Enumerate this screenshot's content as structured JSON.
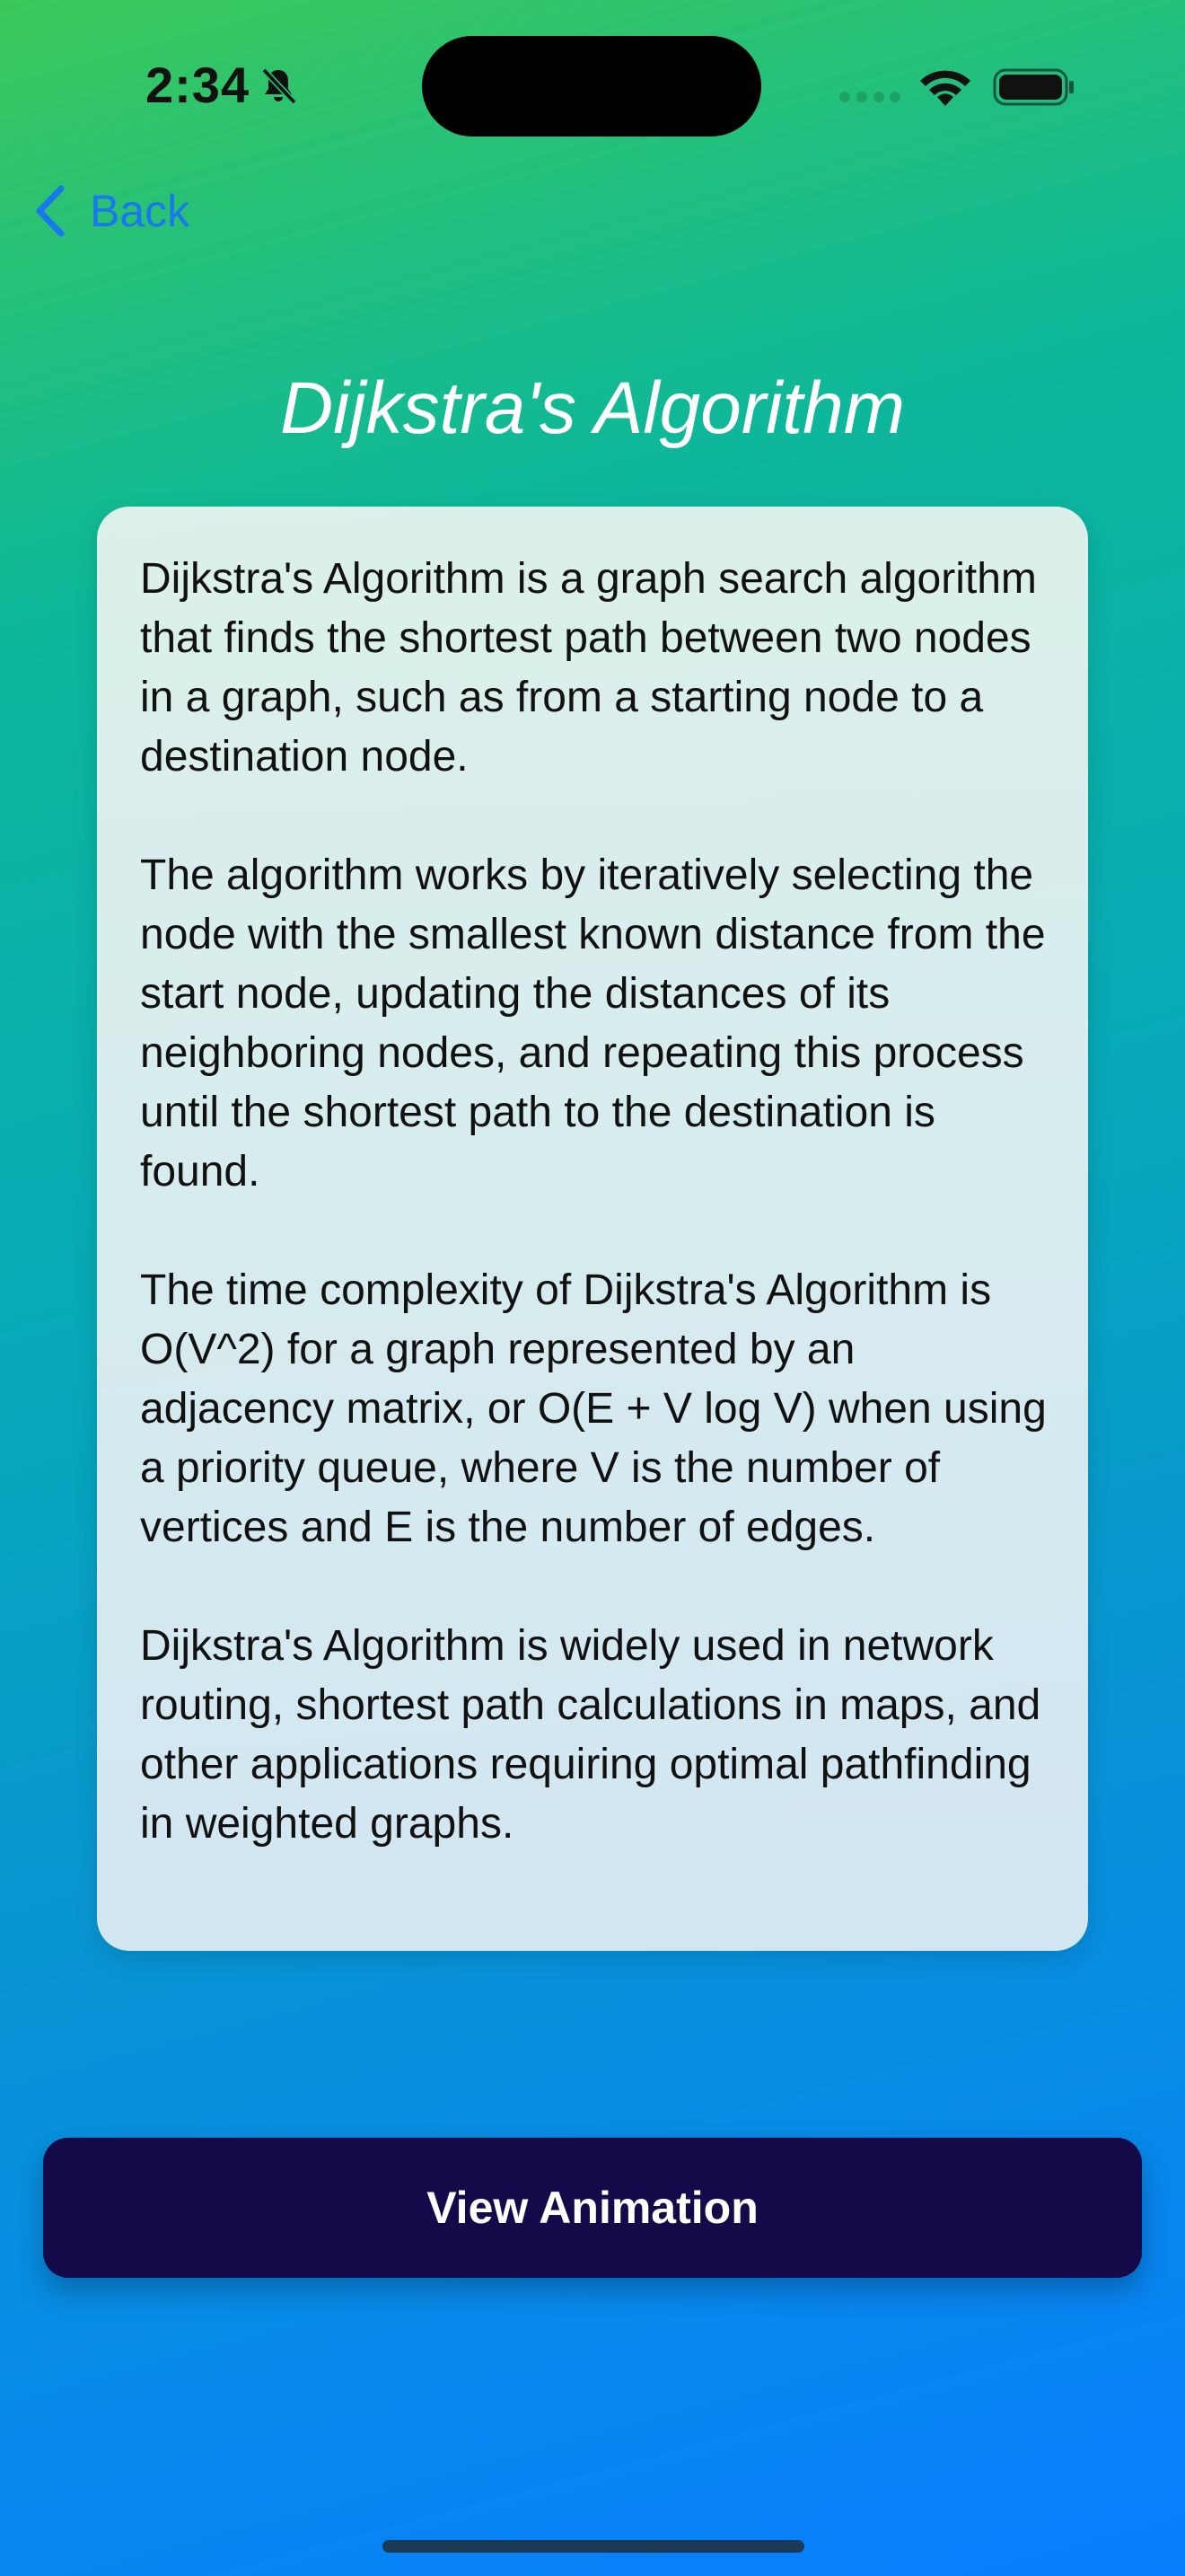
{
  "status_bar": {
    "time": "2:34"
  },
  "navigation": {
    "back_label": "Back"
  },
  "page": {
    "title": "Dijkstra's Algorithm"
  },
  "description": {
    "paragraphs": [
      "Dijkstra's Algorithm is a graph search algorithm that finds the shortest path between two nodes in a graph, such as from a starting node to a destination node.",
      "The algorithm works by iteratively selecting the node with the smallest known distance from the start node, updating the distances of its neighboring nodes, and repeating this process until the shortest path to the destination is found.",
      "The time complexity of Dijkstra's Algorithm is O(V^2) for a graph represented by an adjacency matrix, or O(E + V log V) when using a priority queue, where V is the number of vertices and E is the number of edges.",
      "Dijkstra's Algorithm is widely used in network routing, shortest path calculations in maps, and other applications requiring optimal pathfinding in weighted graphs."
    ]
  },
  "actions": {
    "view_animation_label": "View Animation"
  },
  "icons": {
    "bell": "bell-slash-icon",
    "signal": "cellular-signal-icon",
    "wifi": "wifi-icon",
    "battery": "battery-icon",
    "back": "chevron-left-icon"
  },
  "colors": {
    "accent_link": "#1a78ee",
    "button_background": "#140a4a",
    "title_text": "#ffffff",
    "gradient_top": "#3cc85a",
    "gradient_bottom": "#087dff"
  }
}
